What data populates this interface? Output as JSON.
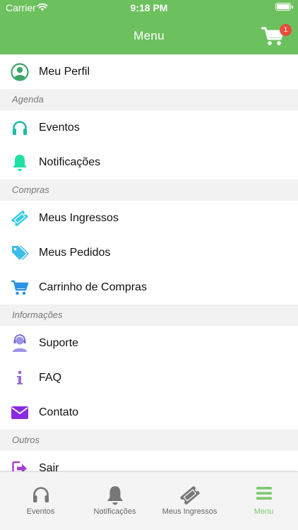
{
  "status_bar": {
    "carrier": "Carrier",
    "time": "9:18 PM"
  },
  "header": {
    "title": "Menu",
    "cart_count": "1"
  },
  "menu": {
    "profile": {
      "label": "Meu Perfil",
      "icon": "user-circle-icon"
    },
    "sections": [
      {
        "title": "Agenda",
        "items": [
          {
            "label": "Eventos",
            "icon": "headphones-icon"
          },
          {
            "label": "Notificações",
            "icon": "bell-icon"
          }
        ]
      },
      {
        "title": "Compras",
        "items": [
          {
            "label": "Meus Ingressos",
            "icon": "ticket-icon"
          },
          {
            "label": "Meus Pedidos",
            "icon": "tags-icon"
          },
          {
            "label": "Carrinho de Compras",
            "icon": "cart-icon"
          }
        ]
      },
      {
        "title": "Informações",
        "items": [
          {
            "label": "Suporte",
            "icon": "support-agent-icon"
          },
          {
            "label": "FAQ",
            "icon": "info-icon"
          },
          {
            "label": "Contato",
            "icon": "envelope-icon"
          }
        ]
      },
      {
        "title": "Outros",
        "items": [
          {
            "label": "Sair",
            "icon": "sign-out-icon"
          }
        ]
      }
    ]
  },
  "tabbar": {
    "tabs": [
      {
        "label": "Eventos",
        "icon": "headphones-icon",
        "active": false
      },
      {
        "label": "Notificações",
        "icon": "bell-icon",
        "active": false
      },
      {
        "label": "Meus Ingressos",
        "icon": "ticket-icon",
        "active": false
      },
      {
        "label": "Menu",
        "icon": "hamburger-icon",
        "active": true
      }
    ]
  },
  "colors": {
    "header_green": "#6cc15e",
    "active_tab": "#7bc96f",
    "badge_red": "#e74c3c",
    "profile_icon": "#3fa56a",
    "eventos_icon": "#1fb9a7",
    "notificacoes_icon": "#1ee0a5",
    "ingressos_icon": "#35cbe8",
    "pedidos_icon": "#3dbde9",
    "carrinho_icon": "#2a93e6",
    "suporte_icon": "#9b94e8",
    "faq_icon": "#9c6bd1",
    "contato_icon": "#8a2be2",
    "sair_icon": "#a43fd1"
  }
}
